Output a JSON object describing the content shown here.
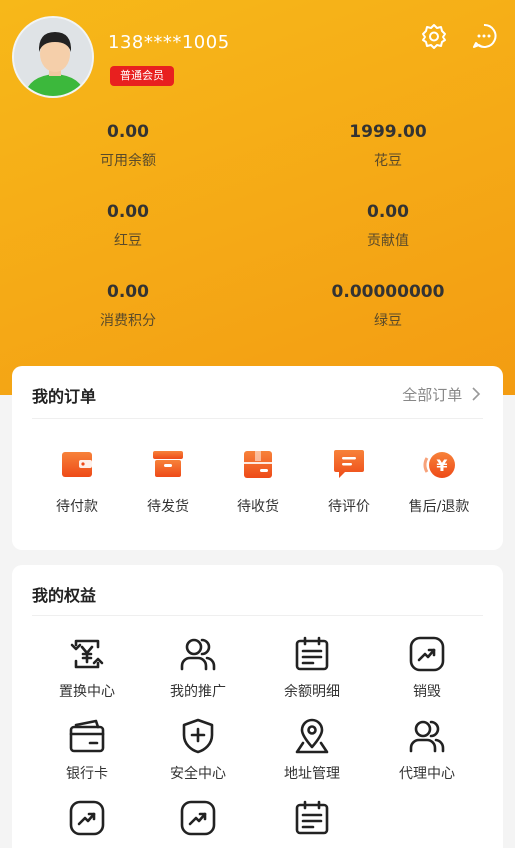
{
  "user": {
    "phone": "138****1005",
    "badge": "普通会员"
  },
  "stats": [
    {
      "value": "0.00",
      "label": "可用余额"
    },
    {
      "value": "1999.00",
      "label": "花豆"
    },
    {
      "value": "0.00",
      "label": "红豆"
    },
    {
      "value": "0.00",
      "label": "贡献值"
    },
    {
      "value": "0.00",
      "label": "消费积分"
    },
    {
      "value": "0.00000000",
      "label": "绿豆"
    }
  ],
  "orders": {
    "title": "我的订单",
    "all_label": "全部订单",
    "items": [
      {
        "label": "待付款",
        "icon": "wallet-icon"
      },
      {
        "label": "待发货",
        "icon": "box-icon"
      },
      {
        "label": "待收货",
        "icon": "package-icon"
      },
      {
        "label": "待评价",
        "icon": "comment-icon"
      },
      {
        "label": "售后/退款",
        "icon": "refund-icon"
      }
    ]
  },
  "benefits": {
    "title": "我的权益",
    "items": [
      {
        "label": "置换中心",
        "icon": "exchange-icon"
      },
      {
        "label": "我的推广",
        "icon": "users-icon"
      },
      {
        "label": "余额明细",
        "icon": "calendar-icon"
      },
      {
        "label": "销毁",
        "icon": "trend-icon"
      },
      {
        "label": "银行卡",
        "icon": "bank-card-icon"
      },
      {
        "label": "安全中心",
        "icon": "shield-icon"
      },
      {
        "label": "地址管理",
        "icon": "location-icon"
      },
      {
        "label": "代理中心",
        "icon": "users-icon"
      },
      {
        "label": "",
        "icon": "trend-icon"
      },
      {
        "label": "",
        "icon": "trend-icon"
      },
      {
        "label": "",
        "icon": "calendar-icon"
      }
    ]
  },
  "colors": {
    "header_gradient_start": "#f7b819",
    "header_gradient_end": "#f39c12",
    "badge_red": "#e8201f",
    "order_icon_orange": "#f05a1c"
  }
}
